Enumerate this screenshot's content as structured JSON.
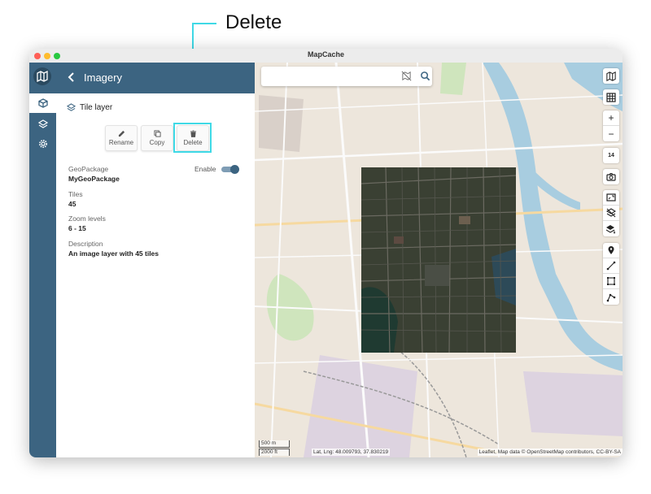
{
  "callout": {
    "label": "Delete"
  },
  "window": {
    "title": "MapCache"
  },
  "header": {
    "title": "Imagery"
  },
  "layer": {
    "type_label": "Tile layer",
    "actions": {
      "rename": "Rename",
      "copy": "Copy",
      "delete": "Delete"
    },
    "enable_label": "Enable",
    "enabled": true,
    "geopackage_label": "GeoPackage",
    "geopackage_value": "MyGeoPackage",
    "tiles_label": "Tiles",
    "tiles_value": "45",
    "zoom_label": "Zoom levels",
    "zoom_value": "6 - 15",
    "description_label": "Description",
    "description_value": "An image layer with 45 tiles"
  },
  "map": {
    "zoom_level": "14",
    "scale_metric": "500 m",
    "scale_imperial": "2000 ft",
    "latlng": "Lat, Lng: 48.009793, 37.830219",
    "attribution": "Leaflet, Map data © OpenStreetMap contributors, CC-BY-SA"
  },
  "colors": {
    "accent": "#3c6481",
    "highlight": "#3fd9e6"
  }
}
